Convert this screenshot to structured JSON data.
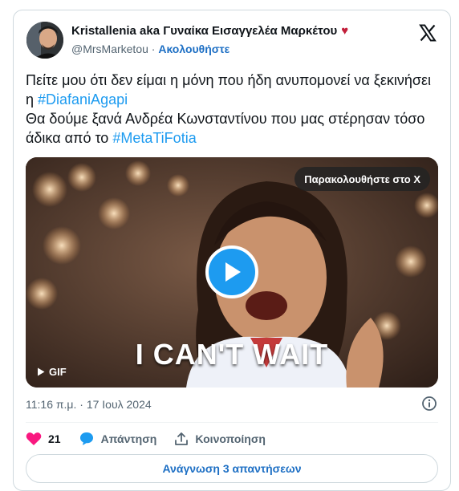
{
  "author": {
    "display_name": "Kristallenia aka Γυναίκα Εισαγγελέα Μαρκέτου",
    "emoji": "♥",
    "handle": "@MrsMarketou",
    "separator": "·",
    "follow_label": "Ακολουθήστε"
  },
  "tweet": {
    "line1": "Πείτε μου ότι δεν είμαι η μόνη που ήδη ανυπομονεί να ξεκινήσει η ",
    "hashtag1": "#DiafaniAgapi",
    "line2": "Θα δούμε ξανά Ανδρέα Κωνσταντίνου που μας στέρησαν τόσο άδικα από το ",
    "hashtag2": "#MetaTiFotia"
  },
  "media": {
    "watch_label": "Παρακολουθήστε στο X",
    "caption": "I CAN'T WAIT",
    "badge": "GIF"
  },
  "timestamp": "11:16 π.μ. · 17 Ιουλ 2024",
  "actions": {
    "like_count": "21",
    "reply_label": "Απάντηση",
    "share_label": "Κοινοποίηση"
  },
  "read_replies_label": "Ανάγνωση 3 απαντήσεων",
  "colors": {
    "accent": "#1d9bf0",
    "link": "#1d6fc4",
    "heart": "#f91880",
    "muted": "#536471"
  }
}
